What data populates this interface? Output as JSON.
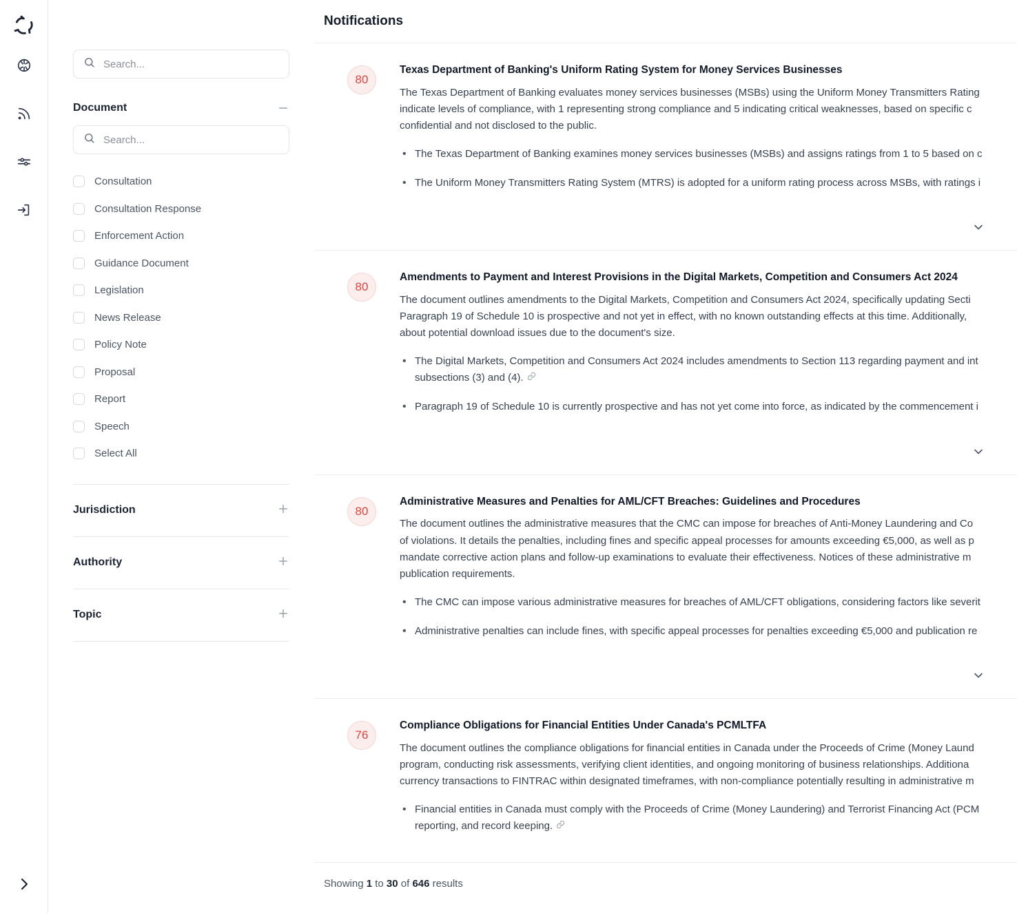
{
  "rail": {
    "logo_icon": "app-logo-icon",
    "icons": [
      {
        "name": "aperture-icon",
        "label": "Aperture"
      },
      {
        "name": "rss-feed-icon",
        "label": "Feed"
      },
      {
        "name": "sliders-filter-icon",
        "label": "Filters"
      },
      {
        "name": "sign-in-icon",
        "label": "Sign in"
      }
    ],
    "expand_icon": "chevron-right-icon"
  },
  "sidebar": {
    "global_search": {
      "value": "",
      "placeholder": "Search..."
    },
    "document_facet": {
      "title": "Document",
      "toggle_icon": "minus-icon",
      "search": {
        "value": "",
        "placeholder": "Search..."
      },
      "options": [
        {
          "label": "Consultation",
          "checked": false
        },
        {
          "label": "Consultation Response",
          "checked": false
        },
        {
          "label": "Enforcement Action",
          "checked": false
        },
        {
          "label": "Guidance Document",
          "checked": false
        },
        {
          "label": "Legislation",
          "checked": false
        },
        {
          "label": "News Release",
          "checked": false
        },
        {
          "label": "Policy Note",
          "checked": false
        },
        {
          "label": "Proposal",
          "checked": false
        },
        {
          "label": "Report",
          "checked": false
        },
        {
          "label": "Speech",
          "checked": false
        },
        {
          "label": "Select All",
          "checked": false
        }
      ]
    },
    "accordions": [
      {
        "title": "Jurisdiction",
        "toggle_icon": "plus-icon"
      },
      {
        "title": "Authority",
        "toggle_icon": "plus-icon"
      },
      {
        "title": "Topic",
        "toggle_icon": "plus-icon"
      }
    ]
  },
  "main": {
    "title": "Notifications",
    "cards": [
      {
        "score": "80",
        "title": "Texas Department of Banking's Uniform Rating System for Money Services Businesses",
        "summary_lines": [
          "The Texas Department of Banking evaluates money services businesses (MSBs) using the Uniform Money Transmitters Rating",
          "indicate levels of compliance, with 1 representing strong compliance and 5 indicating critical weaknesses, based on specific c",
          "confidential and not disclosed to the public."
        ],
        "bullets": [
          {
            "lines": [
              "The Texas Department of Banking examines money services businesses (MSBs) and assigns ratings from 1 to 5 based on c"
            ],
            "clip": false
          },
          {
            "lines": [
              "The Uniform Money Transmitters Rating System (MTRS) is adopted for a uniform rating process across MSBs, with ratings i"
            ],
            "clip": false
          }
        ],
        "expand_icon": "chevron-down-icon"
      },
      {
        "score": "80",
        "title": "Amendments to Payment and Interest Provisions in the Digital Markets, Competition and Consumers Act 2024",
        "summary_lines": [
          "The document outlines amendments to the Digital Markets, Competition and Consumers Act 2024, specifically updating Secti",
          "Paragraph 19 of Schedule 10 is prospective and not yet in effect, with no known outstanding effects at this time. Additionally,",
          "about potential download issues due to the document's size."
        ],
        "bullets": [
          {
            "lines": [
              "The Digital Markets, Competition and Consumers Act 2024 includes amendments to Section 113 regarding payment and int",
              "subsections (3) and (4)."
            ],
            "clip": true
          },
          {
            "lines": [
              "Paragraph 19 of Schedule 10 is currently prospective and has not yet come into force, as indicated by the commencement i"
            ],
            "clip": false
          }
        ],
        "expand_icon": "chevron-down-icon"
      },
      {
        "score": "80",
        "title": "Administrative Measures and Penalties for AML/CFT Breaches: Guidelines and Procedures",
        "summary_lines": [
          "The document outlines the administrative measures that the CMC can impose for breaches of Anti-Money Laundering and Co",
          "of violations. It details the penalties, including fines and specific appeal processes for amounts exceeding €5,000, as well as p",
          "mandate corrective action plans and follow-up examinations to evaluate their effectiveness. Notices of these administrative m",
          "publication requirements."
        ],
        "bullets": [
          {
            "lines": [
              "The CMC can impose various administrative measures for breaches of AML/CFT obligations, considering factors like severit"
            ],
            "clip": false
          },
          {
            "lines": [
              "Administrative penalties can include fines, with specific appeal processes for penalties exceeding €5,000 and publication re"
            ],
            "clip": false
          }
        ],
        "expand_icon": "chevron-down-icon"
      },
      {
        "score": "76",
        "title": "Compliance Obligations for Financial Entities Under Canada's PCMLTFA",
        "summary_lines": [
          "The document outlines the compliance obligations for financial entities in Canada under the Proceeds of Crime (Money Laund",
          "program, conducting risk assessments, verifying client identities, and ongoing monitoring of business relationships. Additiona",
          "currency transactions to FINTRAC within designated timeframes, with non-compliance potentially resulting in administrative m"
        ],
        "bullets": [
          {
            "lines": [
              "Financial entities in Canada must comply with the Proceeds of Crime (Money Laundering) and Terrorist Financing Act (PCM",
              "reporting, and record keeping."
            ],
            "clip": true
          }
        ],
        "expand_icon": ""
      }
    ],
    "footer": {
      "prefix": "Showing ",
      "from": "1",
      "mid1": " to ",
      "to": "30",
      "mid2": " of ",
      "total": "646",
      "suffix": " results"
    }
  },
  "colors": {
    "score_text": "#e2423d",
    "score_bg": "#fdeeee",
    "score_border": "#f6d4d2",
    "text_primary": "#1b2333",
    "text_body": "#374151",
    "border": "#e7e8ec"
  }
}
